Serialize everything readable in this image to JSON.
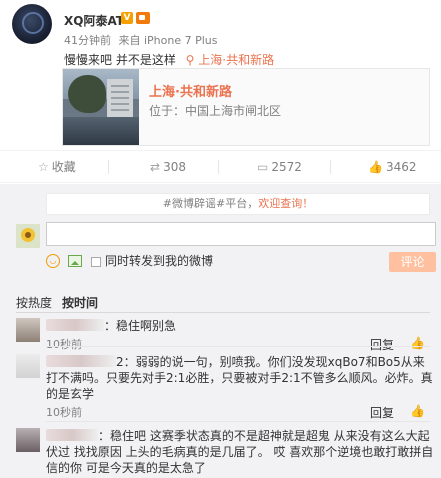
{
  "post": {
    "username": "XQ阿泰AT",
    "badge_v": "V",
    "time": "41分钟前",
    "source": "来自 iPhone 7 Plus",
    "text": "慢慢来吧 并不是这样",
    "location_inline": "上海·共和新路",
    "card": {
      "title": "上海·共和新路",
      "subtitle": "位于：中国上海市闸北区"
    },
    "actions": {
      "favorite": "收藏",
      "repost_count": "308",
      "comment_count": "2572",
      "like_count": "3462"
    }
  },
  "comment_area": {
    "notice_prefix": "#微博辟谣#平台，",
    "notice_link": "欢迎查询！",
    "repost_label": "同时转发到我的微博",
    "submit_label": "评论",
    "sort_hot": "按热度",
    "sort_time": "按时间"
  },
  "comments": [
    {
      "text": "：稳住啊别急",
      "time": "10秒前",
      "reply": "回复"
    },
    {
      "name_visible": "2",
      "text": "：弱弱的说一句，别喷我。你们没发现xqBo7和Bo5从来打不满吗。只要先对手2:1必胜，只要被对手2:1不管多么顺风。必炸。真的是玄学",
      "time": "10秒前",
      "reply": "回复"
    },
    {
      "text": "：稳住吧 这赛季状态真的不是超神就是超鬼 从来没有这么大起伏过 找找原因 上头的毛病真的是几届了。 哎 喜欢那个逆境也敢打敢拼自信的你 可是今天真的是太急了",
      "time": "",
      "reply": ""
    }
  ],
  "colors": {
    "accent": "#eb7350",
    "muted": "#808080",
    "submit_bg": "#ffc09f"
  }
}
